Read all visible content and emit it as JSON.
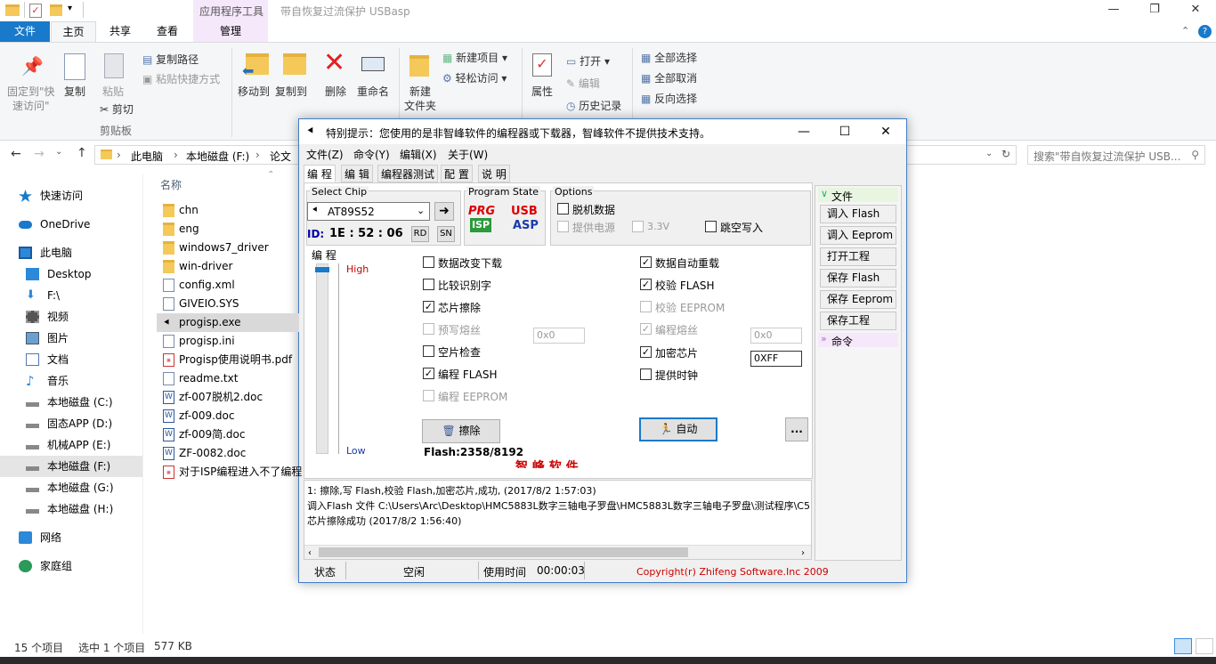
{
  "explorer": {
    "title": "带自恢复过流保护 USBasp",
    "context_tab": "应用程序工具",
    "tabs": [
      "文件",
      "主页",
      "共享",
      "查看",
      "管理"
    ],
    "ribbon": {
      "pin": "固定到\"快",
      "pin2": "速访问\"",
      "copy": "复制",
      "paste": "粘贴",
      "copy_path": "复制路径",
      "paste_shortcut": "粘贴快捷方式",
      "cut": "剪切",
      "clipboard": "剪贴板",
      "move_to": "移动到",
      "copy_to": "复制到",
      "delete": "删除",
      "rename": "重命名",
      "new_folder": "新建",
      "new_folder2": "文件夹",
      "new_item": "新建项目",
      "easy_access": "轻松访问",
      "properties": "属性",
      "open": "打开",
      "edit": "编辑",
      "history": "历史记录",
      "select_all": "全部选择",
      "select_none": "全部取消",
      "invert": "反向选择"
    },
    "breadcrumb": [
      "此电脑",
      "本地磁盘 (F:)",
      "论文"
    ],
    "search_placeholder": "搜索\"带自恢复过流保护 USB...",
    "column_name": "名称",
    "nav": [
      {
        "label": "快速访问",
        "icon": "star-icon"
      },
      {
        "label": "OneDrive",
        "icon": "cloud-icon"
      },
      {
        "label": "此电脑",
        "icon": "computer-icon"
      },
      {
        "label": "Desktop",
        "icon": "desktop-icon"
      },
      {
        "label": "F:\\",
        "icon": "download-icon"
      },
      {
        "label": "视频",
        "icon": "video-icon"
      },
      {
        "label": "图片",
        "icon": "picture-icon"
      },
      {
        "label": "文档",
        "icon": "document-icon"
      },
      {
        "label": "音乐",
        "icon": "music-icon"
      },
      {
        "label": "本地磁盘 (C:)",
        "icon": "drive-icon"
      },
      {
        "label": "固态APP (D:)",
        "icon": "drive-icon"
      },
      {
        "label": "机械APP (E:)",
        "icon": "drive-icon"
      },
      {
        "label": "本地磁盘 (F:)",
        "icon": "drive-icon"
      },
      {
        "label": "本地磁盘 (G:)",
        "icon": "drive-icon"
      },
      {
        "label": "本地磁盘 (H:)",
        "icon": "drive-icon"
      },
      {
        "label": "网络",
        "icon": "network-icon"
      },
      {
        "label": "家庭组",
        "icon": "homegroup-icon"
      }
    ],
    "files": [
      {
        "name": "chn",
        "type": "folder"
      },
      {
        "name": "eng",
        "type": "folder"
      },
      {
        "name": "windows7_driver",
        "type": "folder"
      },
      {
        "name": "win-driver",
        "type": "folder"
      },
      {
        "name": "config.xml",
        "type": "doc"
      },
      {
        "name": "GIVEIO.SYS",
        "type": "doc"
      },
      {
        "name": "progisp.exe",
        "type": "exe"
      },
      {
        "name": "progisp.ini",
        "type": "doc"
      },
      {
        "name": "Progisp使用说明书.pdf",
        "type": "pdf"
      },
      {
        "name": "readme.txt",
        "type": "doc"
      },
      {
        "name": "zf-007脱机2.doc",
        "type": "word"
      },
      {
        "name": "zf-009.doc",
        "type": "word"
      },
      {
        "name": "zf-009简.doc",
        "type": "word"
      },
      {
        "name": "ZF-0082.doc",
        "type": "word"
      },
      {
        "name": "对于ISP编程进入不了编程",
        "type": "pdf"
      }
    ],
    "status_count": "15 个项目",
    "status_selected": "选中 1 个项目",
    "status_size": "577 KB"
  },
  "progisp": {
    "title": "特别提示：您使用的是非智峰软件的编程器或下载器，智峰软件不提供技术支持。",
    "menu": [
      "文件(Z)",
      "命令(Y)",
      "编辑(X)",
      "关于(W)"
    ],
    "tabs": [
      "编 程",
      "编 辑",
      "编程器测试",
      "配 置",
      "说 明"
    ],
    "select_chip_label": "Select Chip",
    "chip": "AT89S52",
    "id_label": "ID:",
    "id_value": "1E : 52 : 06",
    "rd": "RD",
    "sn": "SN",
    "program_state_label": "Program State",
    "prg": "PRG",
    "isp": "ISP",
    "usb": "USB",
    "asp": "ASP",
    "options_label": "Options",
    "opt_offline": "脱机数据",
    "opt_power": "提供电源",
    "opt_33v": "3.3V",
    "opt_skip": "跳空写入",
    "prog_group": "编 程",
    "high": "High",
    "low": "Low",
    "left_opts": [
      {
        "label": "数据改变下载",
        "checked": false,
        "disabled": false
      },
      {
        "label": "比较识别字",
        "checked": false,
        "disabled": false
      },
      {
        "label": "芯片擦除",
        "checked": true,
        "disabled": false
      },
      {
        "label": "预写熔丝",
        "checked": false,
        "disabled": true
      },
      {
        "label": "空片检查",
        "checked": false,
        "disabled": false
      },
      {
        "label": "编程 FLASH",
        "checked": true,
        "disabled": false
      },
      {
        "label": "编程 EEPROM",
        "checked": false,
        "disabled": true
      }
    ],
    "right_opts": [
      {
        "label": "数据自动重载",
        "checked": true,
        "disabled": false
      },
      {
        "label": "校验 FLASH",
        "checked": true,
        "disabled": false
      },
      {
        "label": "校验 EEPROM",
        "checked": false,
        "disabled": true
      },
      {
        "label": "编程熔丝",
        "checked": true,
        "disabled": true
      },
      {
        "label": "加密芯片",
        "checked": true,
        "disabled": false
      },
      {
        "label": "提供时钟",
        "checked": false,
        "disabled": false
      }
    ],
    "hex_prewrite": "0x0",
    "hex_fuse": "0x0",
    "hex_lock": "0XFF",
    "erase_btn": "擦除",
    "auto_btn": "自动",
    "more_btn": "...",
    "flash_info": "Flash:2358/8192",
    "watermark": "智 峰 软 件",
    "log": [
      "1: 擦除,写 Flash,校验 Flash,加密芯片,成功, (2017/8/2 1:57:03)",
      "调入Flash 文件 C:\\Users\\Arc\\Desktop\\HMC5883L数字三轴电子罗盘\\HMC5883L数字三轴电子罗盘\\测试程序\\C51\\",
      "芯片擦除成功 (2017/8/2 1:56:40)"
    ],
    "status_label": "状态",
    "status_value": "空闲",
    "time_label": "使用时间",
    "time_value": "00:00:03",
    "copyright": "Copyright(r) Zhifeng Software.Inc 2009",
    "side_file": "文件",
    "side_buttons": [
      "调入 Flash",
      "调入 Eeprom",
      "打开工程",
      "保存 Flash",
      "保存 Eeprom",
      "保存工程"
    ],
    "side_cmd": "命令"
  },
  "colors": {
    "accent": "#1979ca",
    "ctx_tab": "#f6e8fb",
    "red_text": "#cc0000",
    "log_red": "#cc0000"
  }
}
